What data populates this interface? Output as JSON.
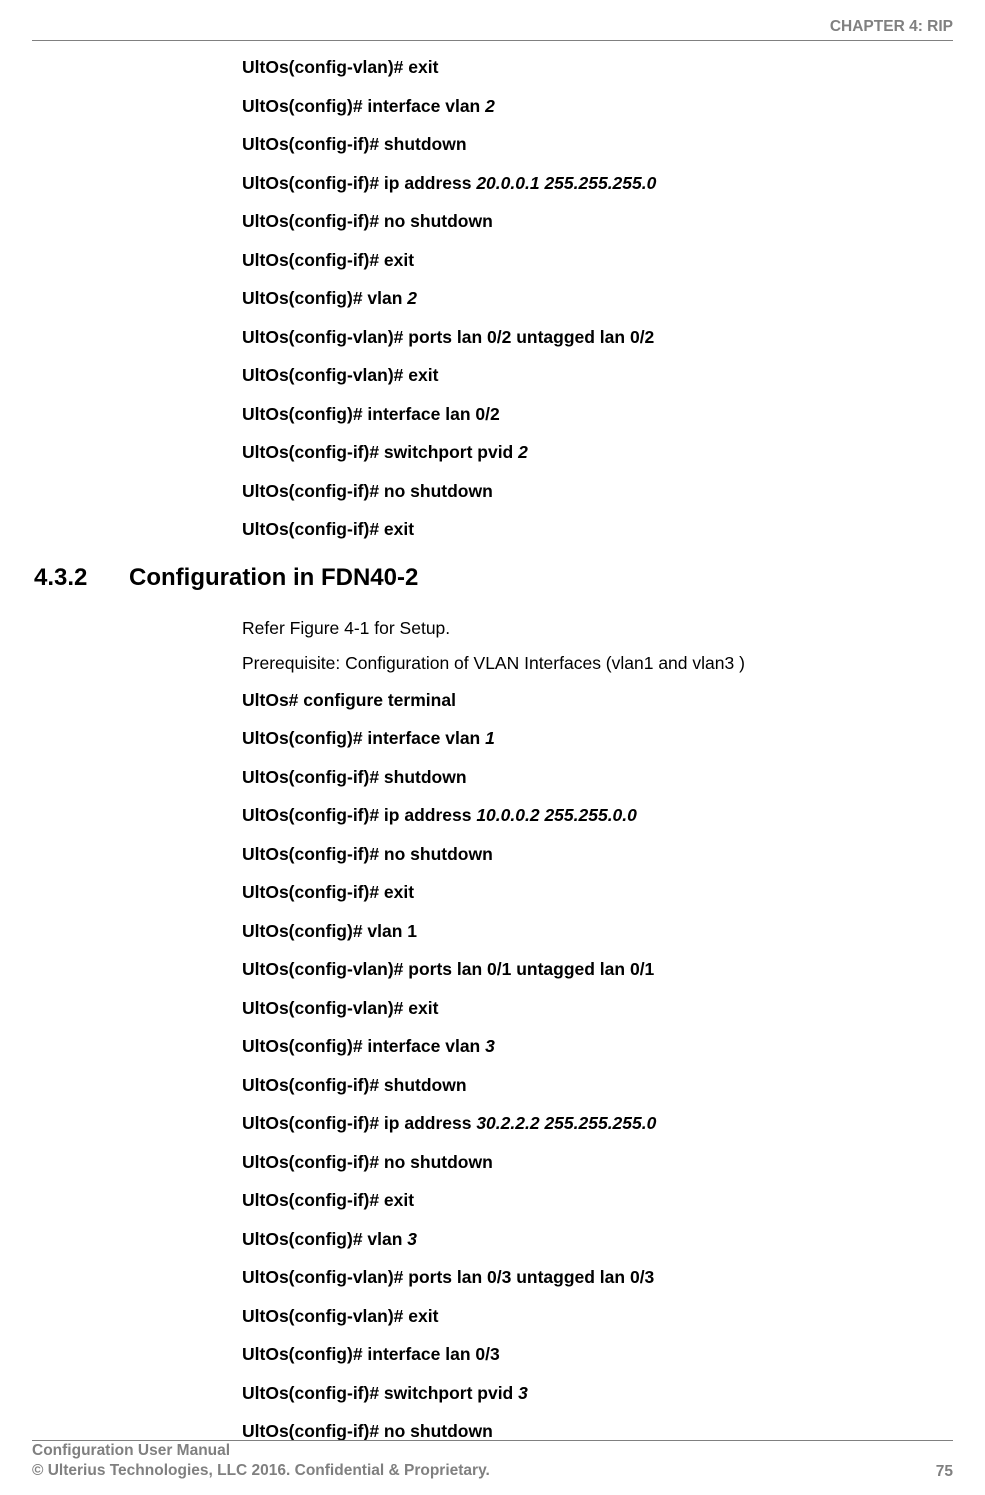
{
  "header": {
    "chapter": "CHAPTER 4: RIP"
  },
  "block1": [
    {
      "prompt": "UltOs(config-vlan)# exit",
      "arg": ""
    },
    {
      "prompt": "UltOs(config)# interface vlan ",
      "arg": "2"
    },
    {
      "prompt": "UltOs(config-if)# shutdown",
      "arg": ""
    },
    {
      "prompt": "UltOs(config-if)# ip address ",
      "arg": "20.0.0.1 255.255.255.0"
    },
    {
      "prompt": "UltOs(config-if)# no shutdown",
      "arg": ""
    },
    {
      "prompt": "UltOs(config-if)# exit",
      "arg": ""
    },
    {
      "prompt": "UltOs(config)# vlan ",
      "arg": "2"
    },
    {
      "prompt": "UltOs(config-vlan)# ports lan 0/2 untagged lan 0/2",
      "arg": ""
    },
    {
      "prompt": "UltOs(config-vlan)# exit",
      "arg": ""
    },
    {
      "prompt": "UltOs(config)# interface lan 0/2",
      "arg": ""
    },
    {
      "prompt": "UltOs(config-if)# switchport pvid ",
      "arg": "2"
    },
    {
      "prompt": "UltOs(config-if)# no shutdown",
      "arg": ""
    },
    {
      "prompt": "UltOs(config-if)# exit",
      "arg": ""
    }
  ],
  "section": {
    "number": "4.3.2",
    "title": "Configuration in FDN40-2"
  },
  "intro": [
    "Refer Figure 4-1 for Setup.",
    "Prerequisite: Configuration of VLAN Interfaces (vlan1 and vlan3 )"
  ],
  "block2": [
    {
      "prompt": "UltOs# configure terminal",
      "arg": ""
    },
    {
      "prompt": "UltOs(config)# interface vlan ",
      "arg": "1"
    },
    {
      "prompt": "UltOs(config-if)# shutdown",
      "arg": ""
    },
    {
      "prompt": "UltOs(config-if)# ip address ",
      "arg": "10.0.0.2 255.255.0.0"
    },
    {
      "prompt": "UltOs(config-if)# no shutdown",
      "arg": ""
    },
    {
      "prompt": "UltOs(config-if)# exit",
      "arg": ""
    },
    {
      "prompt": "UltOs(config)# vlan 1",
      "arg": ""
    },
    {
      "prompt": "UltOs(config-vlan)# ports lan 0/1 untagged lan 0/1",
      "arg": ""
    },
    {
      "prompt": "UltOs(config-vlan)# exit",
      "arg": ""
    },
    {
      "prompt": "UltOs(config)# interface vlan ",
      "arg": "3"
    },
    {
      "prompt": "UltOs(config-if)# shutdown",
      "arg": ""
    },
    {
      "prompt": "UltOs(config-if)# ip address  ",
      "arg": "30.2.2.2 255.255.255.0"
    },
    {
      "prompt": "UltOs(config-if)# no shutdown",
      "arg": ""
    },
    {
      "prompt": "UltOs(config-if)# exit",
      "arg": ""
    },
    {
      "prompt": "UltOs(config)# vlan ",
      "arg": "3"
    },
    {
      "prompt": "UltOs(config-vlan)# ports lan 0/3 untagged lan 0/3",
      "arg": ""
    },
    {
      "prompt": "UltOs(config-vlan)# exit",
      "arg": ""
    },
    {
      "prompt": "UltOs(config)# interface lan 0/3",
      "arg": ""
    },
    {
      "prompt": "UltOs(config-if)# switchport pvid ",
      "arg": "3"
    },
    {
      "prompt": "UltOs(config-if)# no shutdown",
      "arg": ""
    }
  ],
  "footer": {
    "manual": "Configuration User Manual",
    "copyright": "© Ulterius Technologies, LLC 2016. Confidential & Proprietary.",
    "page": "75"
  }
}
